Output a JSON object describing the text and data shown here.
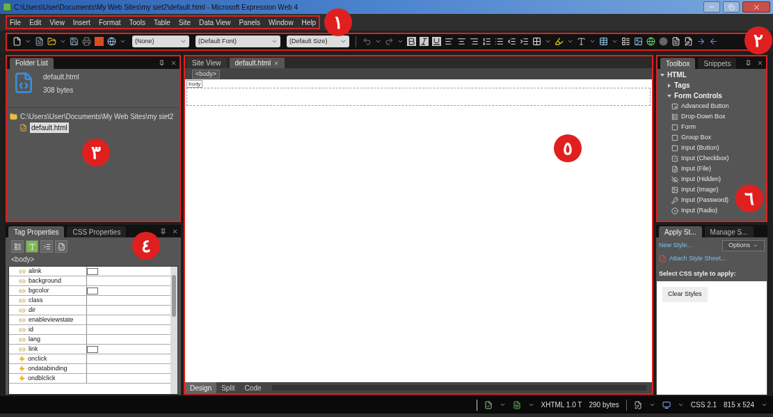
{
  "window": {
    "title": "C:\\Users\\User\\Documents\\My Web Sites\\my siet2\\default.html - Microsoft Expression Web 4"
  },
  "menu_bar": {
    "items": [
      "File",
      "Edit",
      "View",
      "Insert",
      "Format",
      "Tools",
      "Table",
      "Site",
      "Data View",
      "Panels",
      "Window",
      "Help"
    ],
    "callout": "١"
  },
  "toolbar": {
    "dropdowns": [
      "(None)",
      "(Default Font)",
      "(Default Size)"
    ],
    "callout": "٢"
  },
  "folder_list": {
    "tab": "Folder List",
    "file_name": "default.html",
    "file_size": "308 bytes",
    "tree": [
      {
        "label": "C:\\Users\\User\\Documents\\My Web Sites\\my siet2",
        "children": [
          {
            "label": "default.html",
            "selected": true
          }
        ]
      }
    ],
    "callout": "٣"
  },
  "tag_properties": {
    "tabs": [
      {
        "label": "Tag Properties",
        "selected": true
      },
      {
        "label": "CSS Properties",
        "selected": false
      }
    ],
    "tag": "<body>",
    "callout": "٤",
    "rows": [
      {
        "name": "alink",
        "kind": "attribute",
        "swatch": true
      },
      {
        "name": "background",
        "kind": "attribute",
        "swatch": false
      },
      {
        "name": "bgcolor",
        "kind": "attribute",
        "swatch": true
      },
      {
        "name": "class",
        "kind": "attribute",
        "swatch": false
      },
      {
        "name": "dir",
        "kind": "attribute",
        "swatch": false
      },
      {
        "name": "enableviewstate",
        "kind": "attribute",
        "swatch": false
      },
      {
        "name": "id",
        "kind": "attribute",
        "swatch": false
      },
      {
        "name": "lang",
        "kind": "attribute",
        "swatch": false
      },
      {
        "name": "link",
        "kind": "attribute",
        "swatch": true
      },
      {
        "name": "onclick",
        "kind": "event",
        "swatch": false
      },
      {
        "name": "ondatabinding",
        "kind": "event",
        "swatch": false
      },
      {
        "name": "ondblclick",
        "kind": "event",
        "swatch": false
      }
    ]
  },
  "editor": {
    "tabs": [
      {
        "label": "Site View",
        "selected": false,
        "closable": false
      },
      {
        "label": "default.html",
        "selected": true,
        "closable": true
      }
    ],
    "breadcrumb": "<body>",
    "body_label": "body",
    "view_tabs": [
      {
        "label": "Design",
        "selected": true
      },
      {
        "label": "Split",
        "selected": false
      },
      {
        "label": "Code",
        "selected": false
      }
    ],
    "callout": "٥"
  },
  "toolbox": {
    "tabs": [
      {
        "label": "Toolbox",
        "selected": true
      },
      {
        "label": "Snippets",
        "selected": false
      }
    ],
    "callout": "٦",
    "tree": [
      {
        "label": "HTML",
        "expanded": true,
        "children": [
          {
            "label": "Tags",
            "expanded": false
          },
          {
            "label": "Form Controls",
            "expanded": true,
            "children": [
              {
                "label": "Advanced Button"
              },
              {
                "label": "Drop-Down Box"
              },
              {
                "label": "Form"
              },
              {
                "label": "Group Box"
              },
              {
                "label": "Input (Button)"
              },
              {
                "label": "Input (Checkbox)"
              },
              {
                "label": "Input (File)"
              },
              {
                "label": "Input (Hidden)"
              },
              {
                "label": "Input (Image)"
              },
              {
                "label": "Input (Password)"
              },
              {
                "label": "Input (Radio)"
              }
            ]
          }
        ]
      }
    ]
  },
  "apply_styles": {
    "tabs": [
      {
        "label": "Apply St...",
        "selected": true
      },
      {
        "label": "Manage S...",
        "selected": false
      }
    ],
    "new_style": "New Style...",
    "options": "Options",
    "attach": "Attach Style Sheet...",
    "prompt": "Select CSS style to apply:",
    "styles": [
      "Clear Styles"
    ]
  },
  "status_bar": {
    "doctype": "XHTML 1.0 T",
    "size": "290 bytes",
    "css": "CSS 2.1",
    "dimensions": "815 x 524"
  }
}
